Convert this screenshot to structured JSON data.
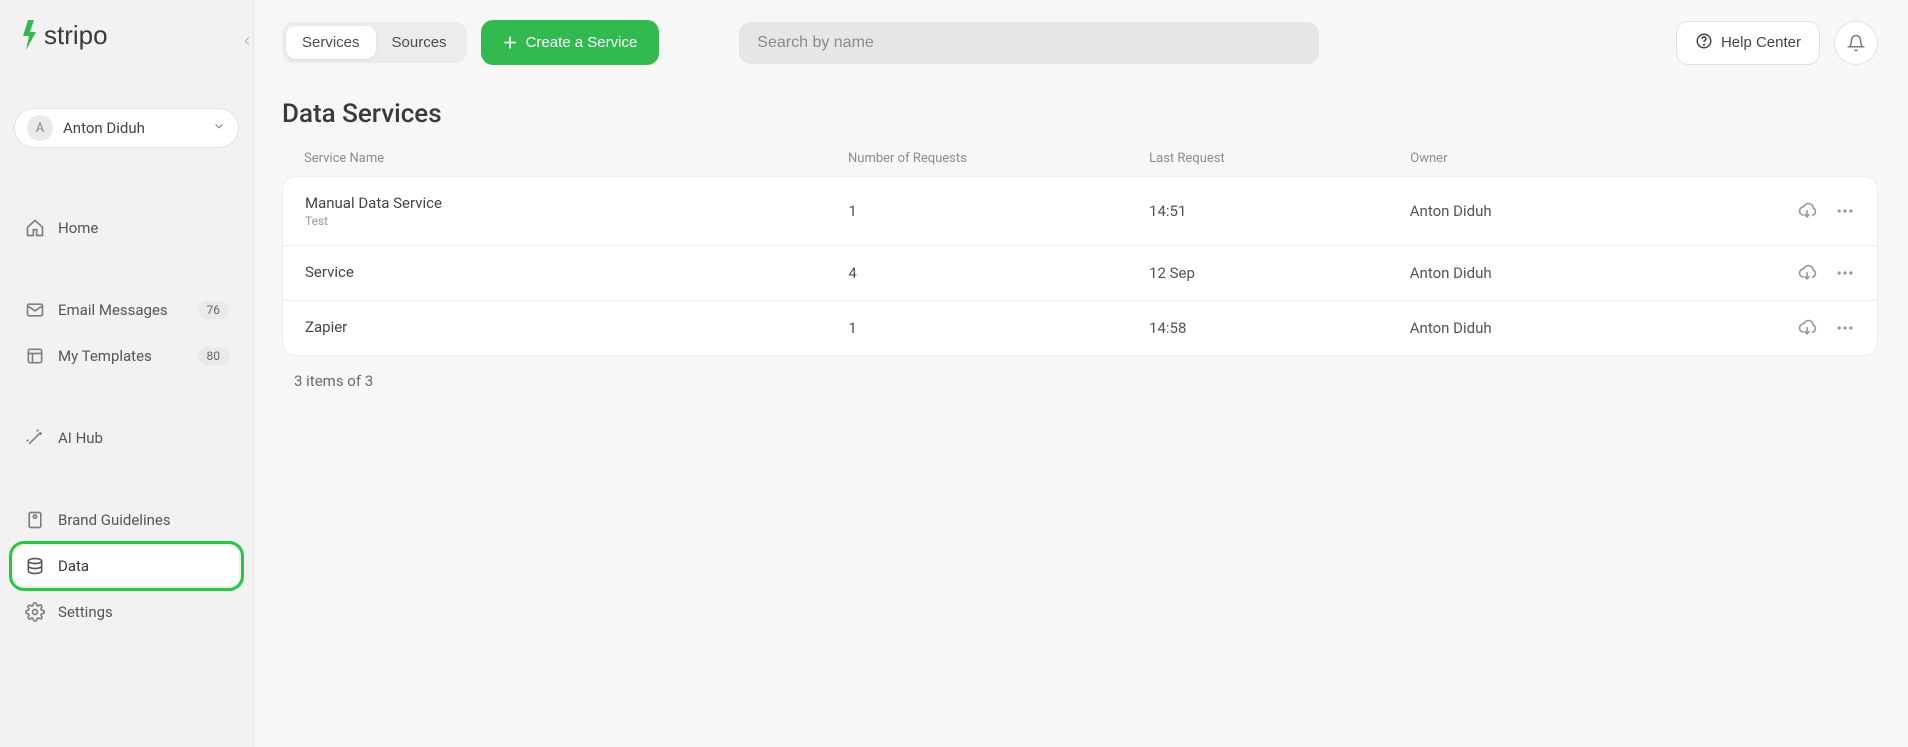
{
  "brand": {
    "name": "stripo"
  },
  "user": {
    "initial": "A",
    "name": "Anton Diduh"
  },
  "sidebar": {
    "items": [
      {
        "label": "Home"
      },
      {
        "label": "Email Messages",
        "badge": "76"
      },
      {
        "label": "My Templates",
        "badge": "80"
      },
      {
        "label": "AI Hub"
      },
      {
        "label": "Brand Guidelines"
      },
      {
        "label": "Data"
      },
      {
        "label": "Settings"
      }
    ]
  },
  "topbar": {
    "tabs": {
      "services": "Services",
      "sources": "Sources"
    },
    "create_label": "Create a Service",
    "search_placeholder": "Search by name",
    "help_label": "Help Center"
  },
  "page": {
    "title": "Data Services"
  },
  "table": {
    "columns": {
      "name": "Service Name",
      "requests": "Number of Requests",
      "last": "Last Request",
      "owner": "Owner"
    },
    "rows": [
      {
        "name": "Manual Data Service",
        "subtitle": "Test",
        "requests": "1",
        "last": "14:51",
        "owner": "Anton Diduh"
      },
      {
        "name": "Service",
        "subtitle": "",
        "requests": "4",
        "last": "12 Sep",
        "owner": "Anton Diduh"
      },
      {
        "name": "Zapier",
        "subtitle": "",
        "requests": "1",
        "last": "14:58",
        "owner": "Anton Diduh"
      }
    ],
    "footer": "3 items of 3"
  }
}
